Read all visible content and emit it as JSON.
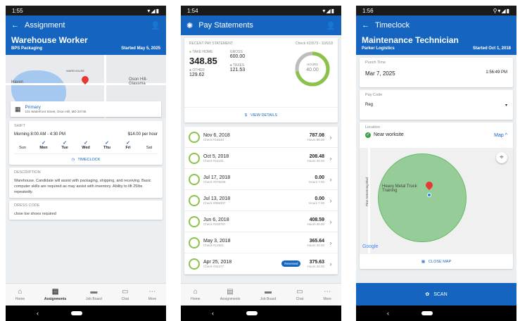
{
  "colors": {
    "primary": "#1565c0",
    "success": "#43a047",
    "ring_green": "#8bc34a",
    "pin": "#e53935"
  },
  "p1": {
    "time": "1:55",
    "title": "Assignment",
    "job": "Warehouse Worker",
    "company": "BPS Packaging",
    "started": "Started May 5, 2025",
    "map_labels": [
      "Haven",
      "WAREHOUSE",
      "Oson Hill-Glassma"
    ],
    "address_type": "Primary",
    "address": "101 Waterfront Street, Oson Hill, MD 20745",
    "shift_label": "SHIFT",
    "shift_time": "Morning 8:00 AM - 4:30 PM",
    "rate": "$14.00 per hour",
    "days": [
      {
        "d": "Sun",
        "c": false
      },
      {
        "d": "Mon",
        "c": true
      },
      {
        "d": "Tue",
        "c": true
      },
      {
        "d": "Wed",
        "c": true
      },
      {
        "d": "Thu",
        "c": true
      },
      {
        "d": "Fri",
        "c": true
      },
      {
        "d": "Sat",
        "c": false
      }
    ],
    "timeclock": "TIMECLOCK",
    "desc_label": "DESCRIPTION",
    "desc": "Warehouse. Candidate will assist with packaging, shipping, and receiving. Basic computer skills are required as may assist with inventory. Ability to lift 25lbs repeatedly.",
    "dress_label": "DRESS CODE",
    "dress": "close toe shoes required"
  },
  "nav": [
    {
      "label": "Home",
      "icon": "home-icon"
    },
    {
      "label": "Assignments",
      "icon": "clipboard-icon"
    },
    {
      "label": "Job Board",
      "icon": "briefcase-icon"
    },
    {
      "label": "Chat",
      "icon": "chat-icon"
    },
    {
      "label": "More",
      "icon": "more-icon"
    }
  ],
  "p2": {
    "time": "1:54",
    "title": "Pay Statements",
    "recent_label": "RECENT PAY STATEMENT",
    "check": "Check #15573 - 11/6/18",
    "take_home_label": "TAKE HOME",
    "take_home": "348.85",
    "gross_label": "GROSS",
    "gross": "600.00",
    "other_label": "OTHER",
    "other": "129.62",
    "taxes_label": "TAXES",
    "taxes": "121.53",
    "hours_label": "HOURS",
    "hours": "40.00",
    "view_details": "VIEW DETAILS",
    "rows": [
      {
        "date": "Nov 6, 2018",
        "check": "Check #16540",
        "amount": "787.08",
        "hours": "Hours 80.00"
      },
      {
        "date": "Oct 5, 2018",
        "check": "Check #15231",
        "amount": "208.48",
        "hours": "Hours 40.00"
      },
      {
        "date": "Jul 17, 2018",
        "check": "Check #078206",
        "amount": "0.00",
        "hours": "Hours 7.00"
      },
      {
        "date": "Jul 13, 2018",
        "check": "Check #068307",
        "amount": "0.00",
        "hours": "Hours 7.00"
      },
      {
        "date": "Jun 6, 2018",
        "check": "Check #239767",
        "amount": "408.59",
        "hours": "Hours 40.00"
      },
      {
        "date": "May 3, 2018",
        "check": "Check #12921",
        "amount": "365.64",
        "hours": "Hours 40.00"
      },
      {
        "date": "Apr 25, 2018",
        "check": "Check #32477",
        "amount": "375.63",
        "hours": "Hours 40.00",
        "badge": "Reversed"
      }
    ]
  },
  "p3": {
    "time": "1:56",
    "title": "Timeclock",
    "job": "Maintenance Technician",
    "company": "Parker Logistics",
    "started": "Started Oct 1, 2018",
    "punch_label": "Punch Time",
    "punch_date": "Mar 7, 2025",
    "punch_time": "1:56:49 PM",
    "pay_label": "Pay Code",
    "pay_value": "Reg",
    "loc_label": "Location",
    "near": "Near worksite",
    "map_link": "Map ^",
    "street": "Pine Armstrong Blvd",
    "poi": "Heavy Metal Truck Training",
    "google": "Google",
    "close_map": "CLOSE MAP",
    "scan": "SCAN"
  }
}
